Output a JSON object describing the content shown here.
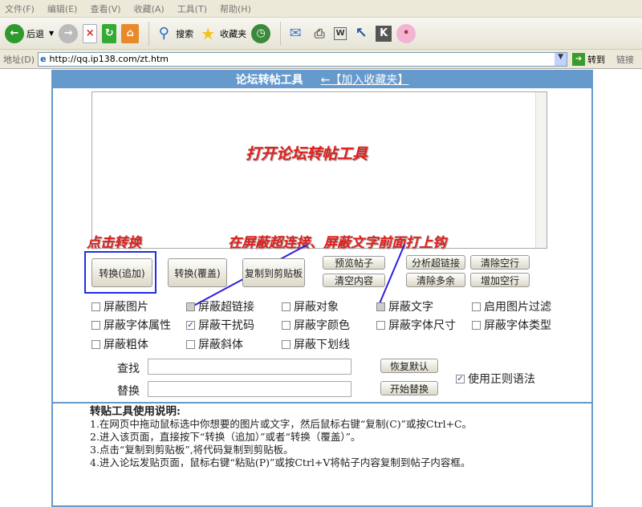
{
  "menu": [
    "文件(F)",
    "编辑(E)",
    "查看(V)",
    "收藏(A)",
    "工具(T)",
    "帮助(H)"
  ],
  "toolbar": {
    "back": "后退",
    "search": "搜索",
    "favorites": "收藏夹"
  },
  "address": {
    "label": "地址(D)",
    "url": "http://qq.ip138.com/zt.htm",
    "go": "转到",
    "links": "链接"
  },
  "header": {
    "title": "论坛转帖工具",
    "bookmark": "←【加入收藏夹】"
  },
  "annotations": {
    "open": "打开论坛转帖工具",
    "click": "点击转换",
    "check": "在屏蔽超连接、屏蔽文字前面打上钩"
  },
  "buttons": {
    "convert_append": "转换(追加)",
    "convert_overwrite": "转换(覆盖)",
    "copy": "复制到剪贴板",
    "preview": "预览帖子",
    "clear": "清空内容",
    "analyze": "分析超链接",
    "clear_blank": "清除空行",
    "clear_extra": "清除多余",
    "add_blank": "增加空行",
    "restore": "恢复默认",
    "replace": "开始替换"
  },
  "options": [
    {
      "label": "屏蔽图片",
      "checked": false
    },
    {
      "label": "屏蔽超链接",
      "checked": false
    },
    {
      "label": "屏蔽对象",
      "checked": false
    },
    {
      "label": "屏蔽文字",
      "checked": false
    },
    {
      "label": "启用图片过滤",
      "checked": false
    },
    {
      "label": "屏蔽字体属性",
      "checked": false
    },
    {
      "label": "屏蔽干扰码",
      "checked": true
    },
    {
      "label": "屏蔽字颜色",
      "checked": false
    },
    {
      "label": "屏蔽字体尺寸",
      "checked": false
    },
    {
      "label": "屏蔽字体类型",
      "checked": false
    },
    {
      "label": "屏蔽粗体",
      "checked": false
    },
    {
      "label": "屏蔽斜体",
      "checked": false
    },
    {
      "label": "屏蔽下划线",
      "checked": false
    }
  ],
  "find": {
    "label": "查找",
    "value": ""
  },
  "replace": {
    "label": "替换",
    "value": ""
  },
  "regex": {
    "label": "使用正则语法",
    "checked": true
  },
  "instructions": {
    "title": "转贴工具使用说明:",
    "lines": [
      "1.在网页中拖动鼠标选中你想要的图片或文字，然后鼠标右键“复制(C)”或按Ctrl+C。",
      "2.进入该页面，直接按下“转换（追加）”或者“转换（覆盖）”。",
      "3.点击“复制到剪贴板”,将代码复制到剪贴板。",
      "4.进入论坛发贴页面，鼠标右键“粘贴(P)”或按Ctrl+V将帖子内容复制到帖子内容框。"
    ]
  }
}
